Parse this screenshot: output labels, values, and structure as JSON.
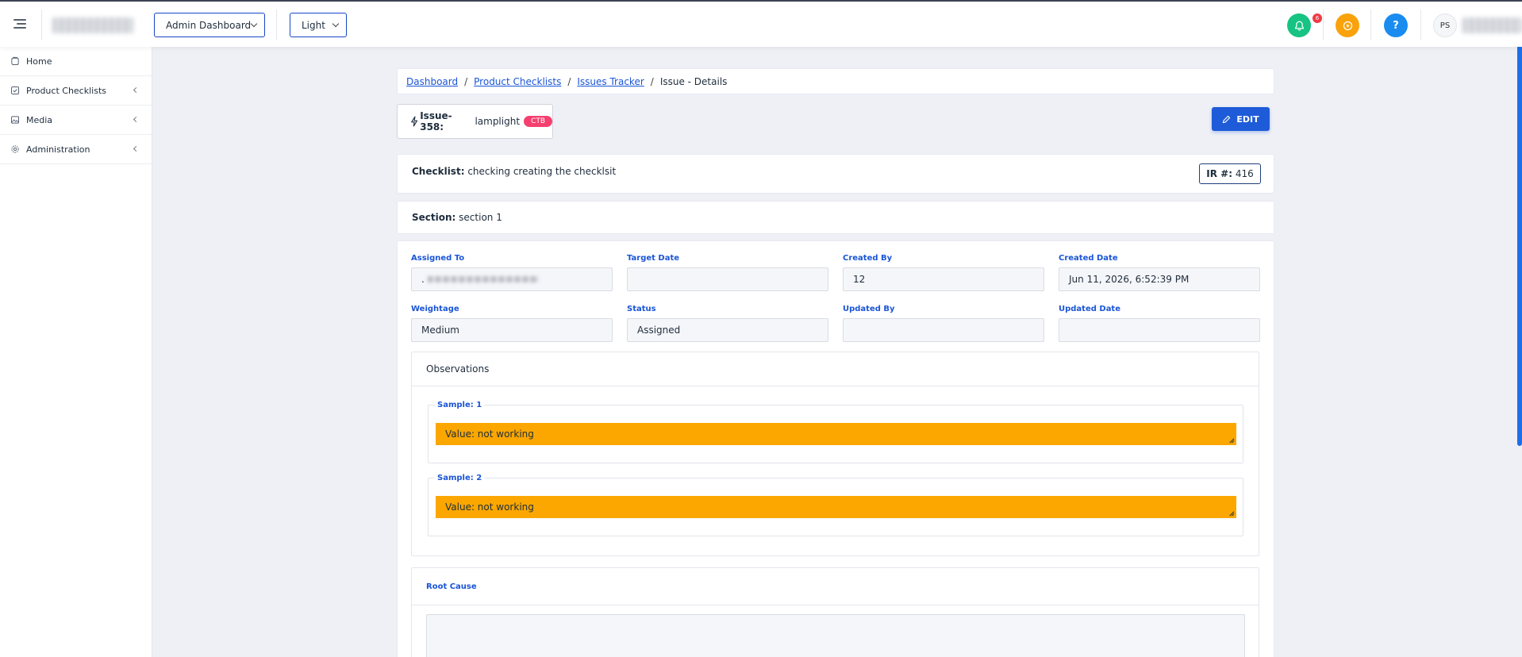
{
  "header": {
    "dashboard_select": "Admin Dashboard",
    "theme_select": "Light",
    "notification_count": "6",
    "help_label": "?",
    "user_initials": "PS"
  },
  "sidebar": {
    "items": [
      {
        "label": "Home",
        "icon": "home-icon"
      },
      {
        "label": "Product Checklists",
        "icon": "checklist-icon"
      },
      {
        "label": "Media",
        "icon": "image-icon"
      },
      {
        "label": "Administration",
        "icon": "gear-icon"
      }
    ]
  },
  "breadcrumb": {
    "items": [
      "Dashboard",
      "Product Checklists",
      "Issues Tracker"
    ],
    "separator": "/",
    "current": "Issue - Details"
  },
  "issue": {
    "id_label": "Issue-358:",
    "name": "lamplight",
    "tag": "CTB"
  },
  "actions": {
    "edit_label": "EDIT"
  },
  "checklist": {
    "label": "Checklist:",
    "value": "checking creating the checklsit"
  },
  "ir": {
    "label": "IR #:",
    "value": "416"
  },
  "section": {
    "label": "Section:",
    "value": "section 1"
  },
  "fields": {
    "assigned_to": {
      "label": "Assigned To",
      "value": "."
    },
    "target_date": {
      "label": "Target Date",
      "value": ""
    },
    "created_by": {
      "label": "Created By",
      "value": "12"
    },
    "created_date": {
      "label": "Created Date",
      "value": "Jun 11, 2026, 6:52:39 PM"
    },
    "weightage": {
      "label": "Weightage",
      "value": "Medium"
    },
    "status": {
      "label": "Status",
      "value": "Assigned"
    },
    "updated_by": {
      "label": "Updated By",
      "value": ""
    },
    "updated_date": {
      "label": "Updated Date",
      "value": ""
    }
  },
  "observations": {
    "title": "Observations",
    "samples": [
      {
        "label": "Sample: 1",
        "value": "Value: not working"
      },
      {
        "label": "Sample: 2",
        "value": "Value: not working"
      }
    ]
  },
  "root_cause": {
    "label": "Root Cause",
    "value": ""
  },
  "colors": {
    "primary": "#1e5bd8",
    "link": "#1a55d6",
    "observation_bg": "#fba700",
    "tag_bg": "#f5406f",
    "notify_btn": "#17c383",
    "play_btn": "#f9a20b",
    "help_btn": "#1a8cf0"
  }
}
